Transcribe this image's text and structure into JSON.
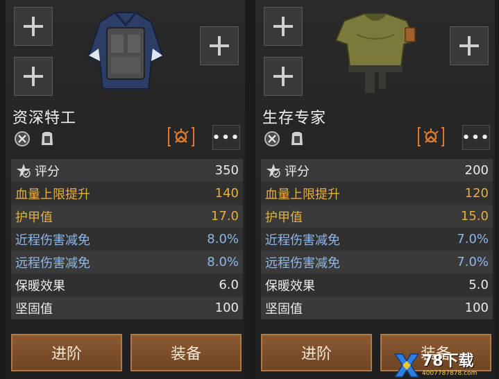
{
  "colors": {
    "gold": "#e7b03d",
    "blue": "#8fb7ea",
    "button": "#7a4d2a",
    "rank": "#e0782a"
  },
  "panels": [
    {
      "item_name": "资深特工",
      "more_label": "•••",
      "stats": {
        "score": {
          "label": "评分",
          "value": "350"
        },
        "hp": {
          "label": "血量上限提升",
          "value": "140"
        },
        "armor": {
          "label": "护甲值",
          "value": "17.0"
        },
        "melee": {
          "label": "近程伤害减免",
          "value": "8.0%"
        },
        "ranged": {
          "label": "远程伤害减免",
          "value": "8.0%"
        },
        "warmth": {
          "label": "保暖效果",
          "value": "6.0"
        },
        "durability": {
          "label": "坚固值",
          "value": "100"
        }
      },
      "buttons": {
        "advance": "进阶",
        "equip": "装备"
      }
    },
    {
      "item_name": "生存专家",
      "more_label": "•••",
      "stats": {
        "score": {
          "label": "评分",
          "value": "200"
        },
        "hp": {
          "label": "血量上限提升",
          "value": "120"
        },
        "armor": {
          "label": "护甲值",
          "value": "15.0"
        },
        "melee": {
          "label": "近程伤害减免",
          "value": "7.0%"
        },
        "ranged": {
          "label": "远程伤害减免",
          "value": "7.0%"
        },
        "warmth": {
          "label": "保暖效果",
          "value": "5.0"
        },
        "durability": {
          "label": "坚固值",
          "value": "100"
        }
      },
      "buttons": {
        "advance": "进阶",
        "equip": "装备"
      }
    }
  ],
  "watermark": {
    "title": "78下载",
    "url": "4007787878.com"
  }
}
